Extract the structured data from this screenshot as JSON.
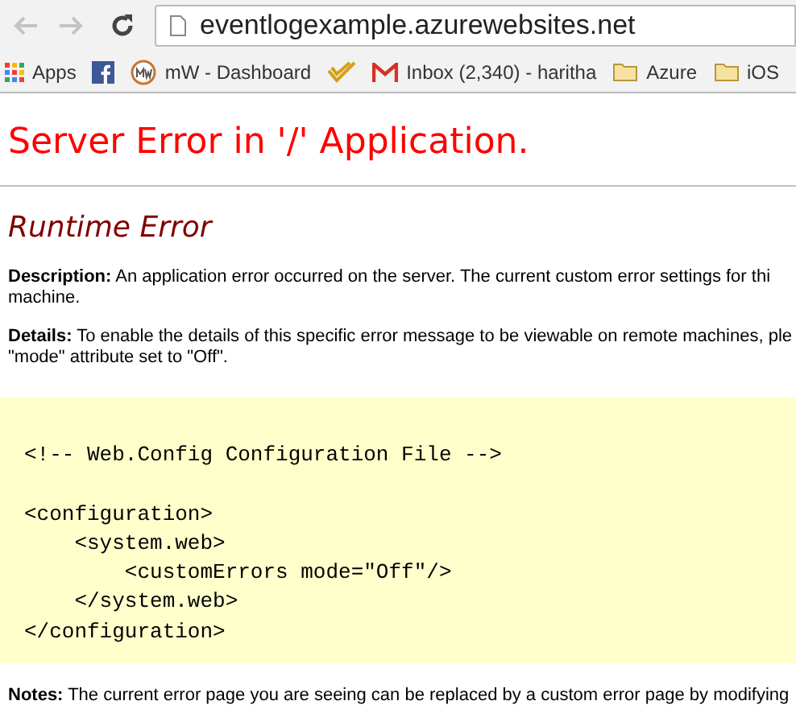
{
  "browser": {
    "url": "eventlogexample.azurewebsites.net",
    "bookmarks": [
      {
        "kind": "apps",
        "label": "Apps"
      },
      {
        "kind": "facebook"
      },
      {
        "kind": "mw",
        "label": "mW - Dashboard"
      },
      {
        "kind": "check"
      },
      {
        "kind": "gmail",
        "label": "Inbox (2,340) - haritha"
      },
      {
        "kind": "folder",
        "label": "Azure"
      },
      {
        "kind": "folder",
        "label": "iOS"
      }
    ]
  },
  "page": {
    "title": "Server Error in '/' Application.",
    "subtitle": "Runtime Error",
    "paragraphs": [
      {
        "lines": [
          "**Description:** An application error occurred on the server. The current custom error settings for thi",
          "machine."
        ]
      },
      {
        "lines": [
          "**Details:** To enable the details of this specific error message to be viewable on remote machines, ple",
          "\"mode\" attribute set to \"Off\"."
        ]
      }
    ],
    "code_groups": [
      [
        "<!-- Web.Config Configuration File -->"
      ],
      [
        "<configuration>",
        "    <system.web>",
        "        <customErrors mode=\"Off\"/>",
        "    </system.web>",
        "</configuration>"
      ]
    ],
    "notes": "**Notes:** The current error page you are seeing can be replaced by a custom error page by modifying"
  }
}
